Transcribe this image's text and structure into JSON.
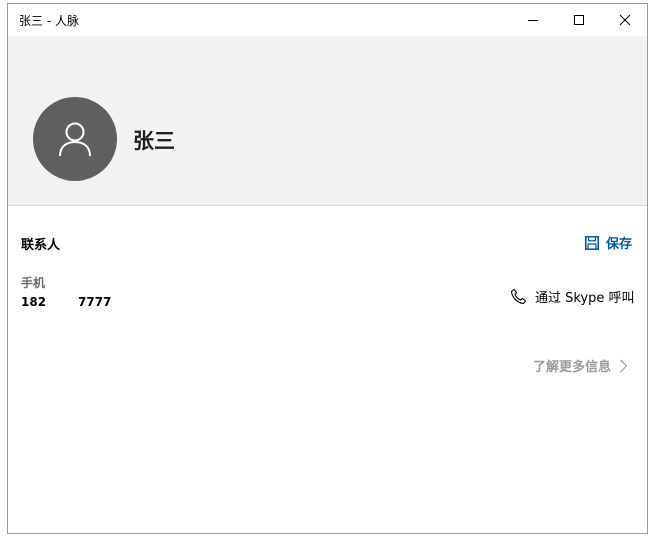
{
  "window": {
    "title": "张三 - 人脉",
    "minimize_icon": "minimize-icon",
    "maximize_icon": "maximize-icon",
    "close_icon": "close-icon"
  },
  "header": {
    "avatar_icon": "person-icon",
    "name": "张三"
  },
  "section": {
    "title": "联系人",
    "save_label": "保存",
    "save_icon": "save-icon"
  },
  "phone": {
    "label": "手机",
    "value_part1": "182",
    "value_part2": "7777"
  },
  "skype": {
    "label": "通过 Skype 呼叫",
    "icon": "phone-icon"
  },
  "learn_more": {
    "label": "了解更多信息",
    "icon": "chevron-right-icon"
  },
  "colors": {
    "accent": "#005a9e",
    "header_bg": "#f2f2f2",
    "avatar_bg": "#5f5f5f"
  }
}
